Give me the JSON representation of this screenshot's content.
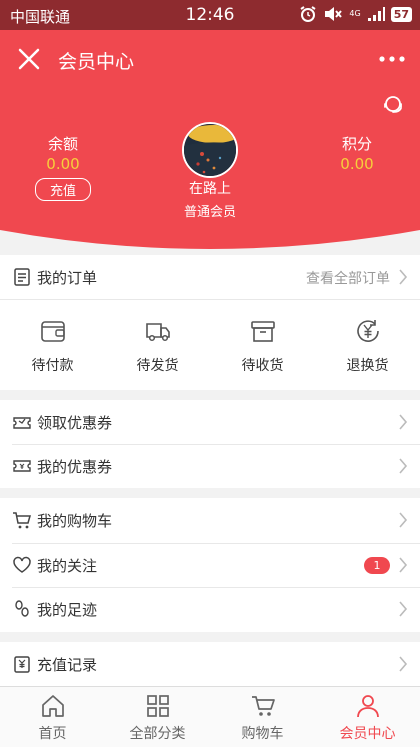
{
  "status_bar": {
    "carrier": "中国联通",
    "time": "12:46",
    "network": "4G",
    "battery": "57"
  },
  "header": {
    "title": "会员中心"
  },
  "profile": {
    "balance_label": "余额",
    "balance_value": "0.00",
    "recharge_label": "充值",
    "points_label": "积分",
    "points_value": "0.00",
    "username": "在路上",
    "member_level": "普通会员"
  },
  "orders": {
    "title": "我的订单",
    "view_all": "查看全部订单",
    "items": [
      {
        "label": "待付款",
        "icon": "wallet-icon"
      },
      {
        "label": "待发货",
        "icon": "truck-icon"
      },
      {
        "label": "待收货",
        "icon": "box-icon"
      },
      {
        "label": "退换货",
        "icon": "yen-refund-icon"
      }
    ]
  },
  "coupons": {
    "get_label": "领取优惠券",
    "mine_label": "我的优惠券"
  },
  "shopping": {
    "cart_label": "我的购物车",
    "follow_label": "我的关注",
    "follow_count": "1",
    "history_label": "我的足迹"
  },
  "recharge_records": {
    "label": "充值记录"
  },
  "tabbar": {
    "tabs": [
      {
        "label": "首页",
        "icon": "home-icon"
      },
      {
        "label": "全部分类",
        "icon": "grid-icon"
      },
      {
        "label": "购物车",
        "icon": "cart-icon"
      },
      {
        "label": "会员中心",
        "icon": "user-icon"
      }
    ]
  },
  "colors": {
    "primary": "#f0484f",
    "status_bar": "#8e2b2f",
    "value_yellow": "#f7cf3b",
    "background": "#f2f2f2"
  }
}
